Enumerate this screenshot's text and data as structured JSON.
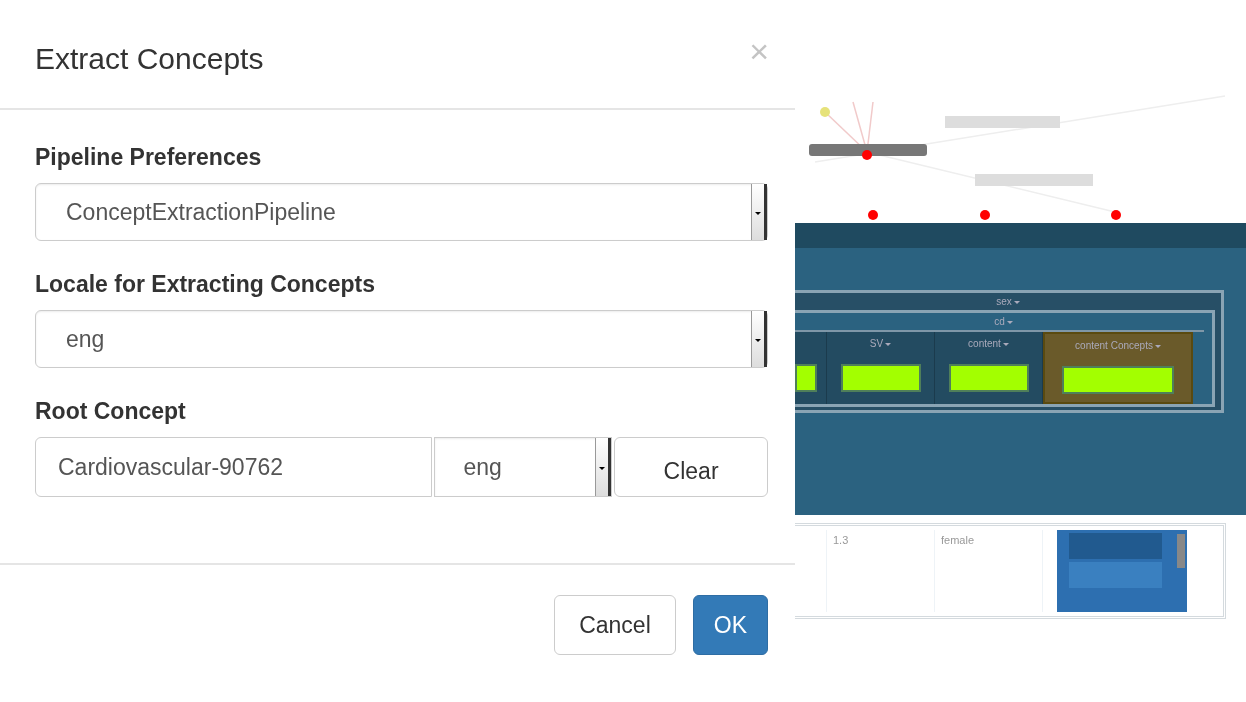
{
  "dialog": {
    "title": "Extract Concepts",
    "close": "×",
    "fields": [
      {
        "kind": "select",
        "label": "Pipeline Preferences",
        "value": "ConceptExtractionPipeline"
      },
      {
        "kind": "select",
        "label": "Locale for Extracting Concepts",
        "value": "eng"
      },
      {
        "kind": "concept",
        "label": "Root Concept",
        "value": "Cardiovascular-90762",
        "locale": "eng",
        "button": "Clear"
      }
    ],
    "buttons": [
      {
        "label": "Cancel",
        "primary": false
      },
      {
        "label": "OK",
        "primary": true
      }
    ]
  },
  "background": {
    "group_headers": [
      "sex",
      "cd"
    ],
    "columns": [
      {
        "selected": false
      },
      {
        "label": "SV",
        "selected": false
      },
      {
        "label": "content",
        "selected": false
      },
      {
        "label": "content Concepts",
        "selected": true
      }
    ],
    "row": [
      "1.3",
      "female"
    ]
  }
}
